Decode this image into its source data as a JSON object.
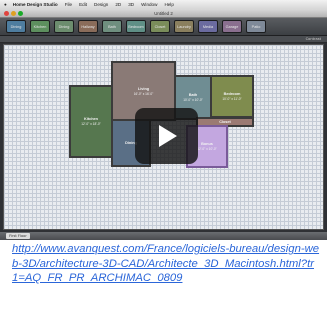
{
  "menubar": {
    "apple": "",
    "app_name": "Home Design Studio",
    "items": [
      "File",
      "Edit",
      "Design",
      "2D",
      "3D",
      "Window",
      "Help"
    ]
  },
  "window": {
    "title": "Untitled 2"
  },
  "toolbar": {
    "rooms": [
      {
        "label": "Dining",
        "color": "#4e7d9f"
      },
      {
        "label": "Kitchen",
        "color": "#5d8f5e"
      },
      {
        "label": "Dining",
        "color": "#6c8d6e"
      },
      {
        "label": "Hallway",
        "color": "#8a6c5a"
      },
      {
        "label": "Bath",
        "color": "#6f8f7f"
      },
      {
        "label": "Bedroom",
        "color": "#5f8f86"
      },
      {
        "label": "Closet",
        "color": "#7a8d5a"
      },
      {
        "label": "Laundry",
        "color": "#8a7f5e"
      },
      {
        "label": "Media",
        "color": "#6b6b9f"
      },
      {
        "label": "Garage",
        "color": "#8a6f8f"
      },
      {
        "label": "Patio",
        "color": "#7f8a99"
      }
    ],
    "contrast_label": "Contrast"
  },
  "plan": {
    "rooms": [
      {
        "name": "Living",
        "dims": "16'-0\" x 16'-0\"",
        "color": "#8a7a76"
      },
      {
        "name": "Kitchen",
        "dims": "12'-0\" x 18'-0\"",
        "color": "#56774f"
      },
      {
        "name": "Dining",
        "dims": "",
        "color": "#5a6f86"
      },
      {
        "name": "Bath",
        "dims": "10'-0\" x 10'-0\"",
        "color": "#6f8d93"
      },
      {
        "name": "Bedroom",
        "dims": "10'-0\" x 11'-0\"",
        "color": "#7f8c4e"
      },
      {
        "name": "Closet",
        "dims": "",
        "color": "#9b7a73"
      },
      {
        "name": "Bonus",
        "dims": "12'-0\" x 10'-0\"",
        "color": "#c3a7e0"
      }
    ]
  },
  "bottombar": {
    "floor_tab": "First Floor"
  },
  "link": {
    "text": "http://www.avanquest.com/France/logiciels-bureau/design-web-3D/architecture-3D-CAD/Architecte_3D_Macintosh.html?tr1=AQ_FR_PR_ARCHIMAC_0809"
  }
}
